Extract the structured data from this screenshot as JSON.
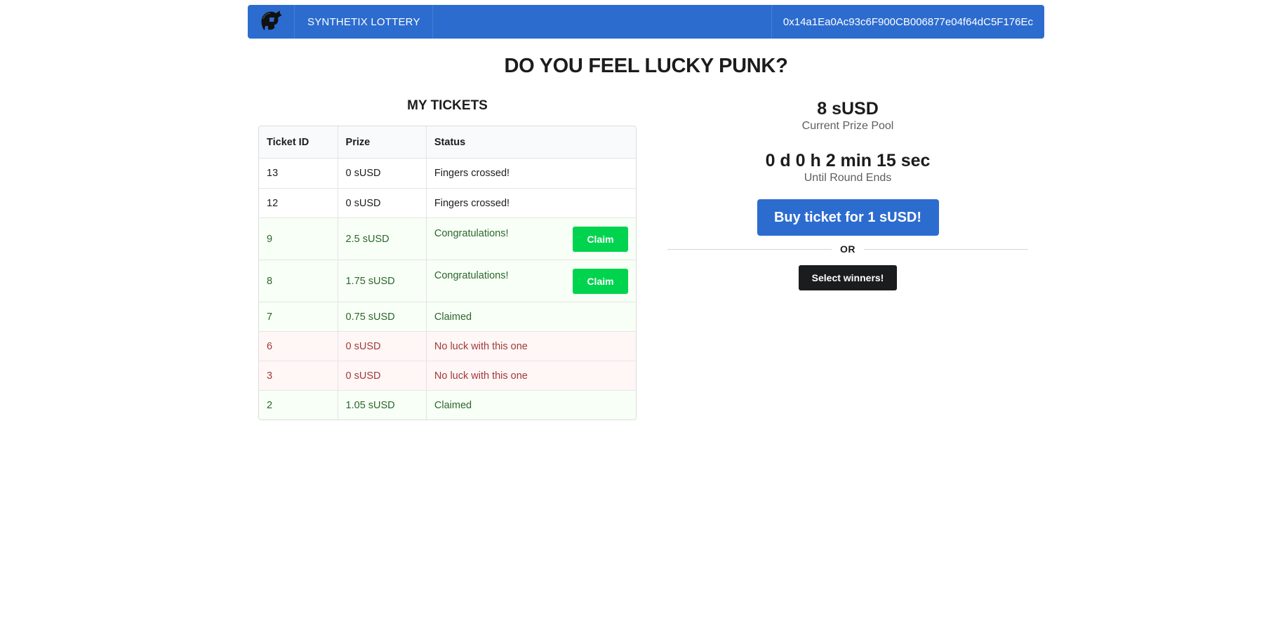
{
  "navbar": {
    "logo_icon": "spartan-helmet-icon",
    "brand": "SYNTHETIX LOTTERY",
    "wallet_address": "0x14a1Ea0Ac93c6F900CB006877e04f64dC5F176Ec"
  },
  "headline": "DO YOU FEEL LUCKY PUNK?",
  "tickets": {
    "title": "MY TICKETS",
    "columns": [
      "Ticket ID",
      "Prize",
      "Status"
    ],
    "claim_label": "Claim",
    "rows": [
      {
        "id": "13",
        "prize": "0 sUSD",
        "status": "Fingers crossed!",
        "state": "pending"
      },
      {
        "id": "12",
        "prize": "0 sUSD",
        "status": "Fingers crossed!",
        "state": "pending"
      },
      {
        "id": "9",
        "prize": "2.5 sUSD",
        "status": "Congratulations!",
        "state": "claimable"
      },
      {
        "id": "8",
        "prize": "1.75 sUSD",
        "status": "Congratulations!",
        "state": "claimable"
      },
      {
        "id": "7",
        "prize": "0.75 sUSD",
        "status": "Claimed",
        "state": "claimed"
      },
      {
        "id": "6",
        "prize": "0 sUSD",
        "status": "No luck with this one",
        "state": "lost"
      },
      {
        "id": "3",
        "prize": "0 sUSD",
        "status": "No luck with this one",
        "state": "lost"
      },
      {
        "id": "2",
        "prize": "1.05 sUSD",
        "status": "Claimed",
        "state": "claimed"
      }
    ]
  },
  "prize_panel": {
    "pool_value": "8 sUSD",
    "pool_label": "Current Prize Pool",
    "countdown_value": "0 d 0 h 2 min 15 sec",
    "countdown_label": "Until Round Ends",
    "buy_button": "Buy ticket for 1 sUSD!",
    "or_text": "OR",
    "select_button": "Select winners!"
  },
  "colors": {
    "primary": "#2d6ccf",
    "claim_green": "#00d44f",
    "positive_text": "#2c662d",
    "positive_bg": "#f8fff6",
    "negative_text": "#9f3a38",
    "negative_bg": "#fff6f6",
    "dark_button": "#1b1c1d"
  }
}
